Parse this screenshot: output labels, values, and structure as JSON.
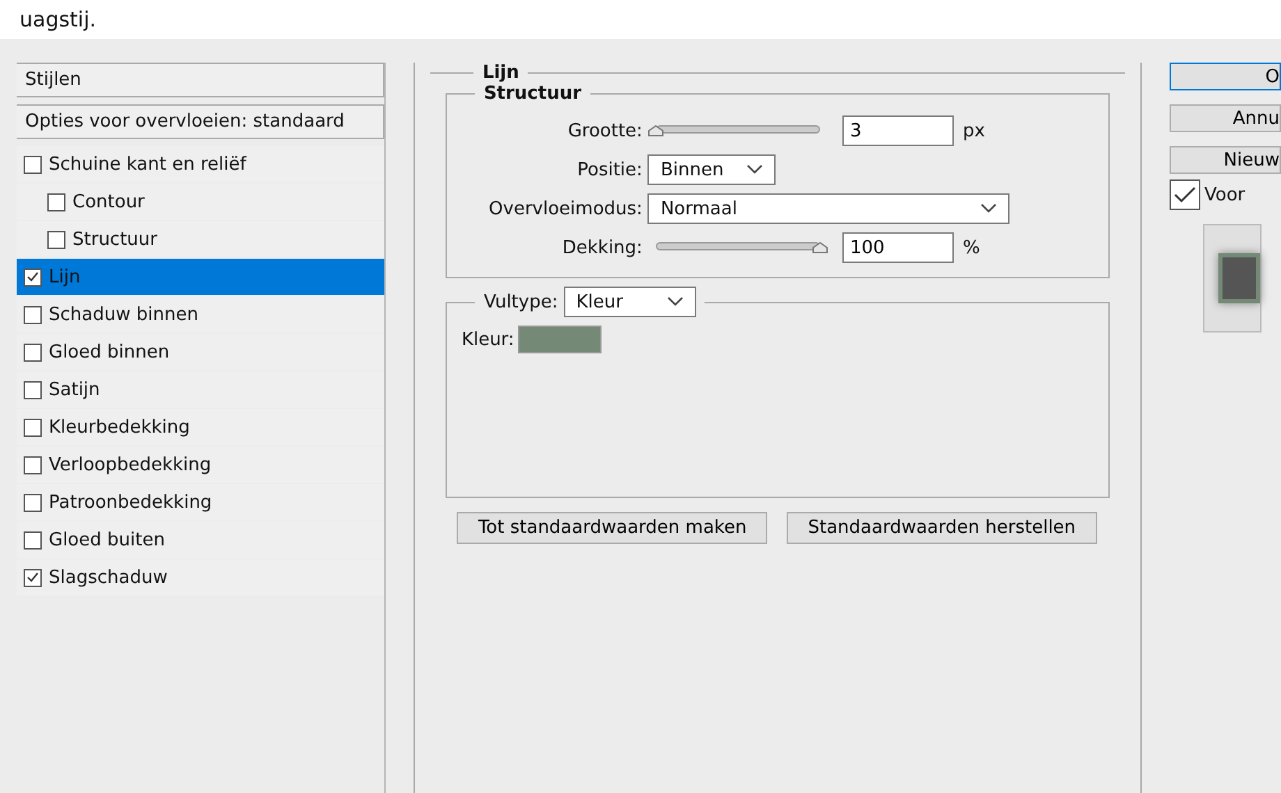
{
  "caption": "uagstij.",
  "sidebar": {
    "header": "Stijlen",
    "blend_options": "Opties voor overvloeien: standaard",
    "items": [
      {
        "label": "Schuine kant en reliëf",
        "checked": false,
        "selected": false,
        "children": [
          {
            "label": "Contour",
            "checked": false,
            "selected": false
          },
          {
            "label": "Structuur",
            "checked": false,
            "selected": false
          }
        ]
      },
      {
        "label": "Lijn",
        "checked": true,
        "selected": true
      },
      {
        "label": "Schaduw binnen",
        "checked": false,
        "selected": false
      },
      {
        "label": "Gloed binnen",
        "checked": false,
        "selected": false
      },
      {
        "label": "Satijn",
        "checked": false,
        "selected": false
      },
      {
        "label": "Kleurbedekking",
        "checked": false,
        "selected": false
      },
      {
        "label": "Verloopbedekking",
        "checked": false,
        "selected": false
      },
      {
        "label": "Patroonbedekking",
        "checked": false,
        "selected": false
      },
      {
        "label": "Gloed buiten",
        "checked": false,
        "selected": false
      },
      {
        "label": "Slagschaduw",
        "checked": true,
        "selected": false
      }
    ]
  },
  "panel": {
    "title": "Lijn",
    "structure": {
      "title": "Structuur",
      "size": {
        "label": "Grootte:",
        "level": 0.0,
        "value": "3",
        "unit": "px"
      },
      "position": {
        "label": "Positie:",
        "value": "Binnen"
      },
      "blend_mode": {
        "label": "Overvloeimodus:",
        "value": "Normaal"
      },
      "opacity": {
        "label": "Dekking:",
        "level": 1.0,
        "value": "100",
        "unit": "%"
      }
    },
    "fill": {
      "label": "Vultype:",
      "value": "Kleur",
      "color_label": "Kleur:",
      "color": "#748a76"
    },
    "buttons": [
      "Tot standaardwaarden maken",
      "Standaardwaarden herstellen"
    ]
  },
  "right": {
    "buttons": [
      "O",
      "Annu",
      "Nieuw"
    ],
    "preview": {
      "label": "Voor",
      "checked": true
    }
  }
}
